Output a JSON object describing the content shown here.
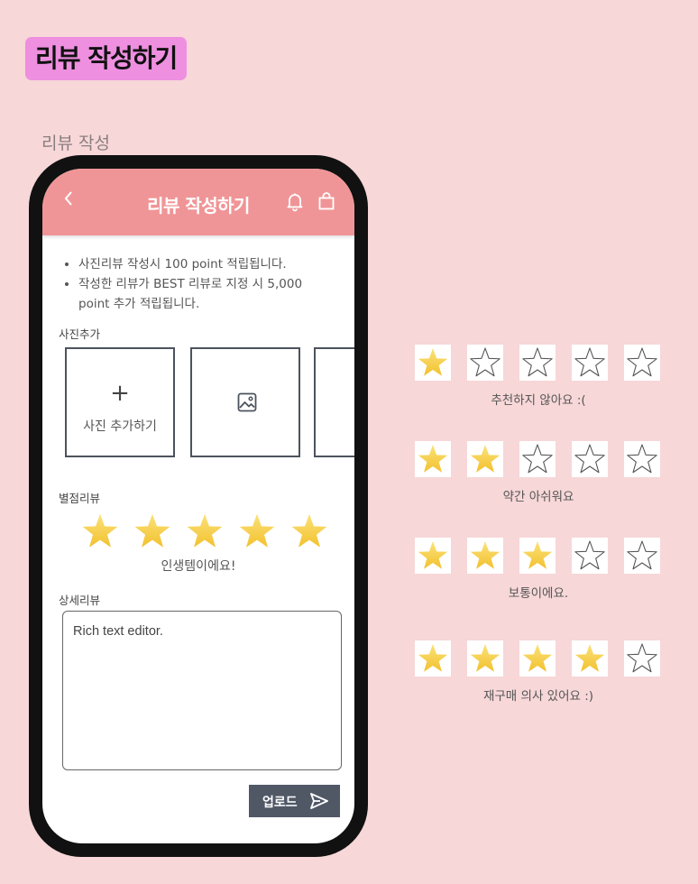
{
  "page": {
    "title": "리뷰 작성하기",
    "section_caption": "리뷰 작성"
  },
  "app": {
    "header_title": "리뷰 작성하기",
    "header_color": "#f09597",
    "icons": {
      "back": "chevron-left-icon",
      "bell": "bell-icon",
      "bag": "shopping-bag-icon"
    },
    "notices": [
      "사진리뷰 작성시 100 point 적립됩니다.",
      "작성한 리뷰가 BEST 리뷰로 지정 시 5,000 point 추가 적립됩니다."
    ],
    "photo_section": {
      "label": "사진추가",
      "add_icon": "+",
      "add_label": "사진 추가하기"
    },
    "rating_section": {
      "label": "별점리뷰",
      "stars": 5,
      "max": 5,
      "text": "인생템이에요!"
    },
    "detail_section": {
      "label": "상세리뷰",
      "placeholder": "Rich text editor."
    },
    "upload_button": {
      "label": "업로드"
    }
  },
  "rating_legend": [
    {
      "stars": 1,
      "max": 5,
      "text": "추천하지 않아요 :("
    },
    {
      "stars": 2,
      "max": 5,
      "text": "약간 아쉬워요"
    },
    {
      "stars": 3,
      "max": 5,
      "text": "보통이에요."
    },
    {
      "stars": 4,
      "max": 5,
      "text": "재구매 의사 있어요 :)"
    }
  ],
  "colors": {
    "background": "#f7d7d8",
    "title_highlight": "#ee8fe0",
    "star": "#f6cd3c",
    "button": "#505866"
  }
}
